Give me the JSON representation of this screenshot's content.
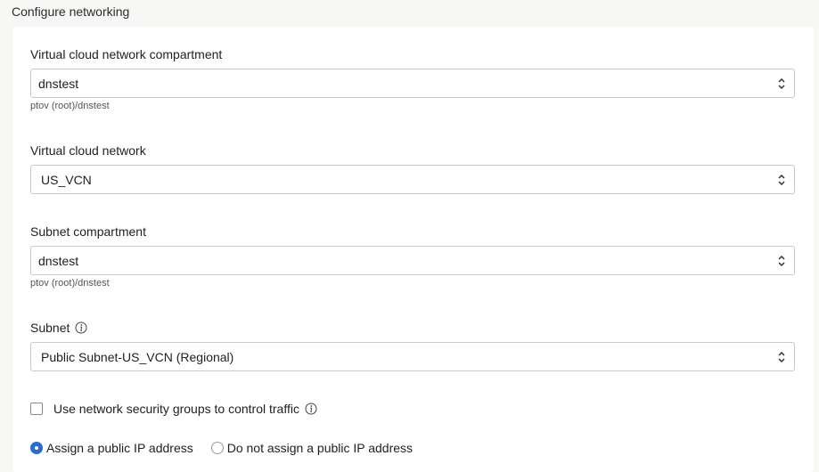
{
  "section": {
    "title": "Configure networking"
  },
  "vcn_compartment": {
    "label": "Virtual cloud network compartment",
    "value": "dnstest",
    "helper": "ptov (root)/dnstest"
  },
  "vcn": {
    "label": "Virtual cloud network",
    "value": "US_VCN"
  },
  "subnet_compartment": {
    "label": "Subnet compartment",
    "value": "dnstest",
    "helper": "ptov (root)/dnstest"
  },
  "subnet": {
    "label": "Subnet",
    "value": "Public Subnet-US_VCN (Regional)"
  },
  "nsg": {
    "label": "Use network security groups to control traffic",
    "checked": false
  },
  "public_ip": {
    "options": [
      {
        "label": "Assign a public IP address",
        "selected": true
      },
      {
        "label": "Do not assign a public IP address",
        "selected": false
      }
    ]
  },
  "colors": {
    "accent": "#2a6ad2",
    "border": "#c9c9c9"
  }
}
